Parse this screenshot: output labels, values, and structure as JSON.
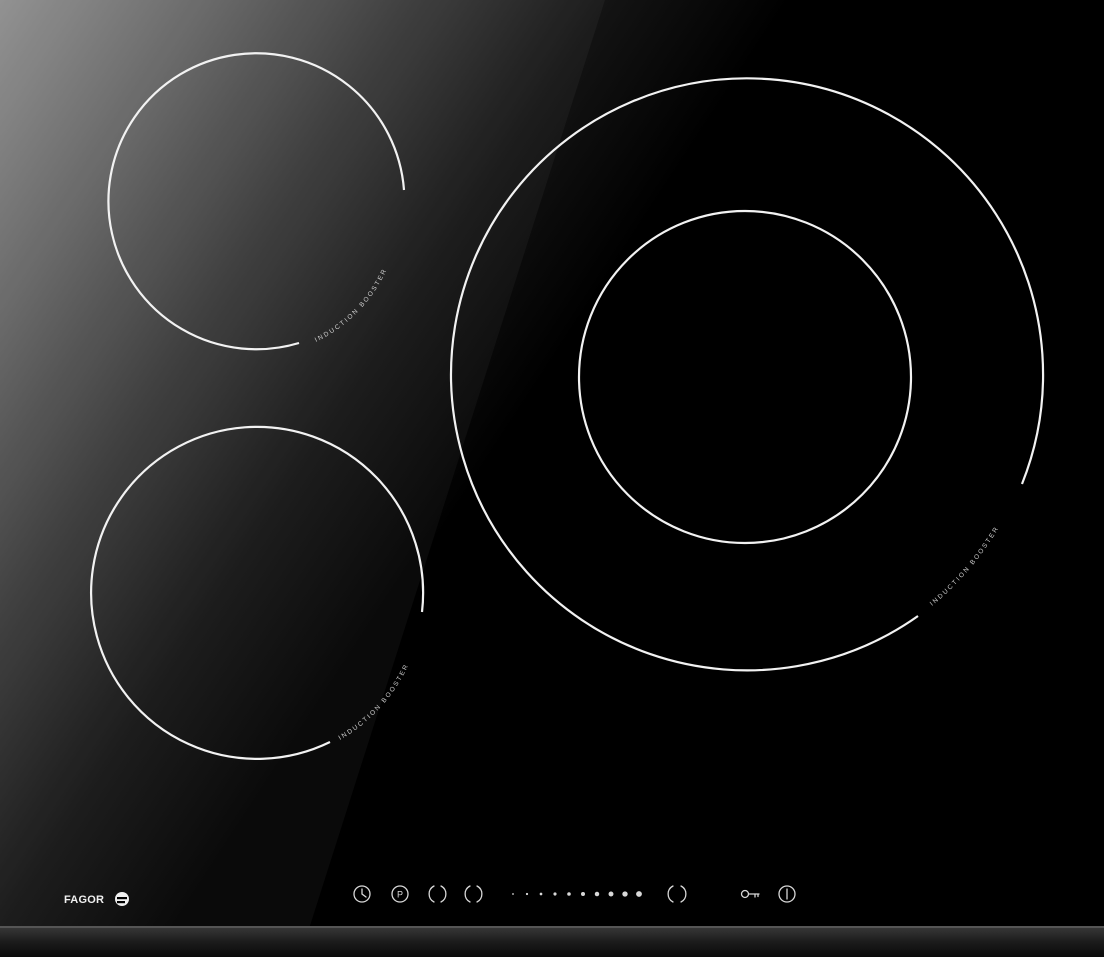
{
  "brand": {
    "name": "FAGOR"
  },
  "zones": {
    "top_left": {
      "label": "INDUCTION BOOSTER"
    },
    "bottom_left": {
      "label": "INDUCTION BOOSTER"
    },
    "right": {
      "label": "INDUCTION BOOSTER"
    }
  },
  "controls": {
    "timer_icon": "clock-icon",
    "pause_label": "P",
    "minus_icon": "minus-bracket-icon",
    "plus_icon": "plus-bracket-icon",
    "slider_level": 0,
    "slider_dots": 10,
    "boost_icon": "boost-bracket-icon",
    "lock_icon": "key-icon",
    "power_icon": "power-icon"
  },
  "colors": {
    "glass": "#000000",
    "reflection": "#8c8c8c",
    "markings": "#f2f2f2",
    "frame": "#1e1e1e"
  }
}
